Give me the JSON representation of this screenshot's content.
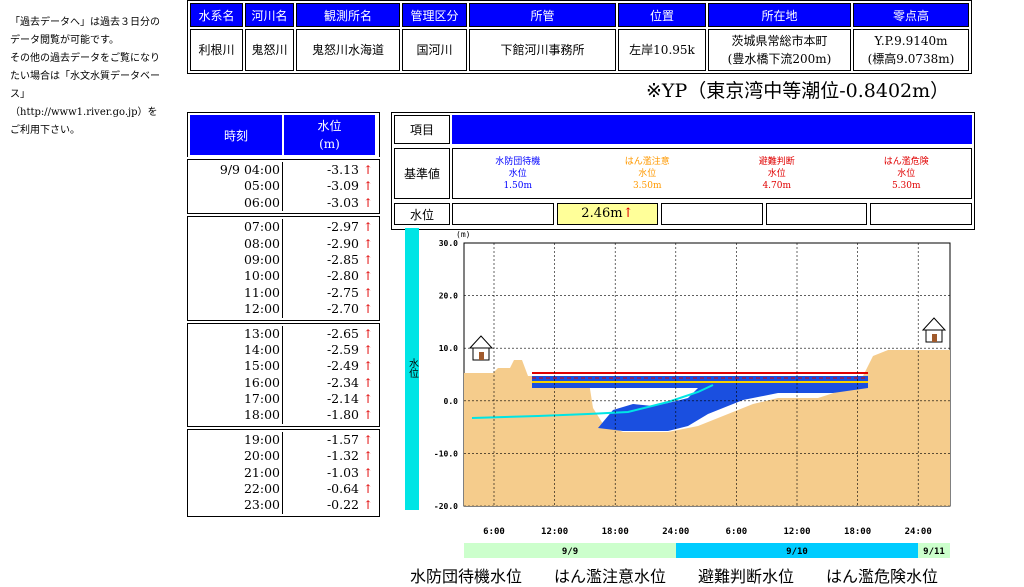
{
  "side_note": {
    "lines": [
      "「過去データへ」は過去３日分の",
      "データ閲覧が可能です。",
      "その他の過去データをご覧になり",
      "たい場合は「水文水質データベー",
      "ス」",
      "（http://www1.river.go.jp）を",
      "ご利用下さい。"
    ]
  },
  "station": {
    "headers": [
      "水系名",
      "河川名",
      "観測所名",
      "管理区分",
      "所管",
      "位置",
      "所在地",
      "零点高"
    ],
    "values": [
      "利根川",
      "鬼怒川",
      "鬼怒川水海道",
      "国河川",
      "下館河川事務所",
      "左岸10.95k"
    ],
    "location_line1": "茨城県常総市本町",
    "location_line2": "(豊水橋下流200m)",
    "datum_line1": "Y.P.9.9140m",
    "datum_line2": "(標高9.0738m)"
  },
  "yp_note": "※YP（東京湾中等潮位-0.8402m）",
  "time_table": {
    "header_time": "時刻",
    "header_level_line1": "水位",
    "header_level_line2": "(m)",
    "arrow": "↑",
    "groups": [
      [
        {
          "t": "9/9 04:00",
          "v": "-3.13"
        },
        {
          "t": "05:00",
          "v": "-3.09"
        },
        {
          "t": "06:00",
          "v": "-3.03"
        }
      ],
      [
        {
          "t": "07:00",
          "v": "-2.97"
        },
        {
          "t": "08:00",
          "v": "-2.90"
        },
        {
          "t": "09:00",
          "v": "-2.85"
        },
        {
          "t": "10:00",
          "v": "-2.80"
        },
        {
          "t": "11:00",
          "v": "-2.75"
        },
        {
          "t": "12:00",
          "v": "-2.70"
        }
      ],
      [
        {
          "t": "13:00",
          "v": "-2.65"
        },
        {
          "t": "14:00",
          "v": "-2.59"
        },
        {
          "t": "15:00",
          "v": "-2.49"
        },
        {
          "t": "16:00",
          "v": "-2.34"
        },
        {
          "t": "17:00",
          "v": "-2.14"
        },
        {
          "t": "18:00",
          "v": "-1.80"
        }
      ],
      [
        {
          "t": "19:00",
          "v": "-1.57"
        },
        {
          "t": "20:00",
          "v": "-1.32"
        },
        {
          "t": "21:00",
          "v": "-1.03"
        },
        {
          "t": "22:00",
          "v": "-0.64"
        },
        {
          "t": "23:00",
          "v": "-0.22"
        }
      ]
    ]
  },
  "items": {
    "item_label": "項目",
    "standard_label": "基準値",
    "level_label": "水位",
    "current_level": "2.46m",
    "current_arrow": "↑",
    "levels": [
      {
        "name": "水防団待機",
        "sub": "水位",
        "value": "1.50m",
        "color": "#0000ff"
      },
      {
        "name": "はん濫注意",
        "sub": "水位",
        "value": "3.50m",
        "color": "#ff9900"
      },
      {
        "name": "避難判断",
        "sub": "水位",
        "value": "4.70m",
        "color": "#e00000"
      },
      {
        "name": "はん濫危険",
        "sub": "水位",
        "value": "5.30m",
        "color": "#e00000"
      }
    ]
  },
  "chart": {
    "unit": "(m)",
    "y_axis_label": "水位",
    "y_ticks": [
      "30.0",
      "20.0",
      "10.0",
      "0.0",
      "-10.0",
      "-20.0"
    ],
    "x_ticks": [
      "6:00",
      "12:00",
      "18:00",
      "24:00",
      "6:00",
      "12:00",
      "18:00",
      "24:00"
    ],
    "dates": [
      "9/9",
      "9/10",
      "9/11"
    ]
  },
  "legend_text": "水防団待機水位　　はん濫注意水位　　避難判断水位　　はん濫危険水位"
}
